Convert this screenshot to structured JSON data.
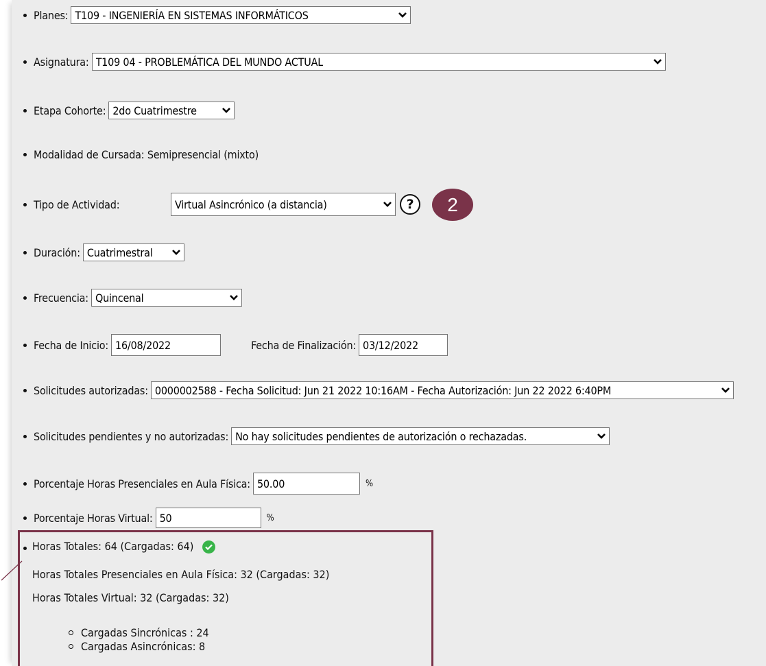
{
  "plan": {
    "label": "Planes:",
    "value": "T109 - INGENIERÍA EN SISTEMAS INFORMÁTICOS"
  },
  "asignatura": {
    "label": "Asignatura:",
    "value": "T109  04 - PROBLEMÁTICA DEL MUNDO ACTUAL"
  },
  "etapa": {
    "label": "Etapa Cohorte:",
    "value": "2do Cuatrimestre"
  },
  "modalidad": {
    "text": "Modalidad de Cursada: Semipresencial (mixto)"
  },
  "tipo_actividad": {
    "label": "Tipo de Actividad:",
    "value": "Virtual Asincrónico (a distancia)",
    "help_symbol": "?"
  },
  "step_badge": "2",
  "duracion": {
    "label": "Duración:",
    "value": "Cuatrimestral"
  },
  "frecuencia": {
    "label": "Frecuencia:",
    "value": "Quincenal"
  },
  "fechas": {
    "inicio_label": "Fecha de Inicio:",
    "inicio_value": "16/08/2022",
    "fin_label": "Fecha de Finalización:",
    "fin_value": "03/12/2022"
  },
  "solicitudes_autorizadas": {
    "label": "Solicitudes autorizadas:",
    "value": "0000002588 - Fecha Solicitud: Jun 21 2022 10:16AM - Fecha Autorización: Jun 22 2022 6:40PM"
  },
  "solicitudes_pendientes": {
    "label": "Solicitudes pendientes y no autorizadas:",
    "value": "No hay solicitudes pendientes de autorización o rechazadas."
  },
  "porcentaje_presencial": {
    "label": "Porcentaje Horas Presenciales en Aula Física:",
    "value": "50.00",
    "unit": "%"
  },
  "porcentaje_virtual": {
    "label": "Porcentaje Horas Virtual:",
    "value": "50",
    "unit": "%"
  },
  "resumen": {
    "horas_totales": "Horas Totales:  64 (Cargadas: 64)",
    "horas_presenciales": "Horas Totales Presenciales en Aula Física:  32 (Cargadas: 32)",
    "horas_virtual": "Horas Totales Virtual:  32 (Cargadas: 32)",
    "sincronicas": "Cargadas Sincrónicas : 24",
    "asincronicas": "Cargadas Asincrónicas: 8",
    "status_icon": "check-circle-icon"
  },
  "colors": {
    "accent": "#7a3349",
    "panel_bg": "#ececec",
    "check": "#38b449"
  }
}
